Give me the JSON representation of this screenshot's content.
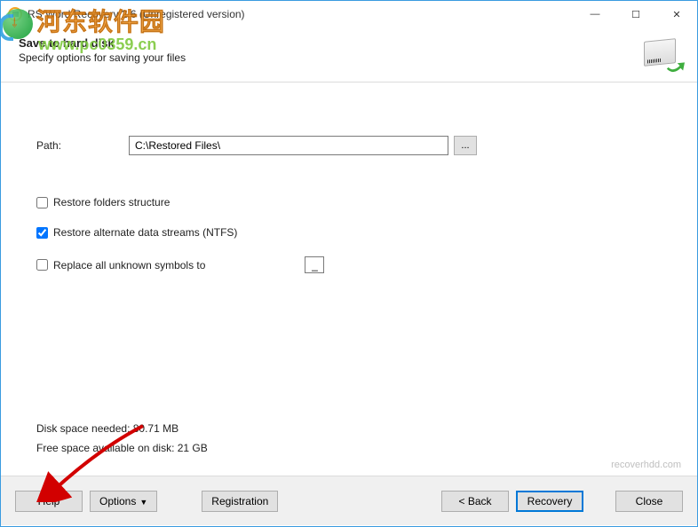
{
  "window": {
    "title": "RS Word Recovery 2.6 (Unregistered version)",
    "minimize": "—",
    "maximize": "☐",
    "close": "✕"
  },
  "header": {
    "title": "Save to hard disk",
    "subtitle": "Specify options for saving your files"
  },
  "watermark": {
    "line1": "河东软件园",
    "line2": "www.pc0359.cn"
  },
  "form": {
    "path_label": "Path:",
    "path_value": "C:\\Restored Files\\",
    "browse": "...",
    "chk_folders": {
      "label": "Restore folders structure",
      "checked": false
    },
    "chk_ads": {
      "label": "Restore alternate data streams (NTFS)",
      "checked": true
    },
    "chk_symbols": {
      "label": "Replace all unknown symbols to",
      "checked": false,
      "value": "_"
    }
  },
  "info": {
    "needed": "Disk space needed: 80.71 MB",
    "free": "Free space available on disk: 21 GB"
  },
  "brand": "recoverhdd.com",
  "buttons": {
    "help": "Help",
    "options": "Options",
    "caret": "▼",
    "registration": "Registration",
    "back": "< Back",
    "recovery": "Recovery",
    "close": "Close"
  }
}
